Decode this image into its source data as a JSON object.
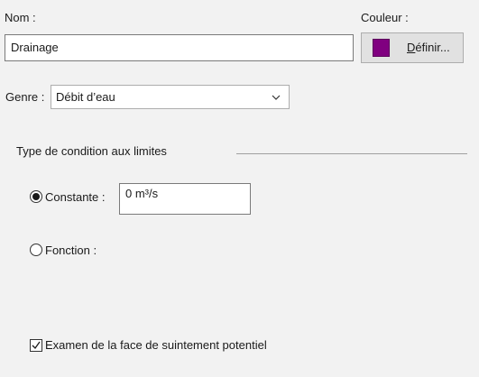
{
  "name": {
    "label": "Nom :",
    "value": "Drainage"
  },
  "color": {
    "label": "Couleur :",
    "swatch": "#800080",
    "button_mnemonic": "D",
    "button_rest": "éfinir..."
  },
  "genre": {
    "label": "Genre :",
    "selected": "Débit d’eau"
  },
  "boundary": {
    "group_title": "Type de condition aux limites",
    "constant_label": "Constante :",
    "constant_value": "0 m³/s",
    "function_label": "Fonction :"
  },
  "seepage": {
    "label": "Examen de la face de suintement potentiel",
    "checked": true
  }
}
